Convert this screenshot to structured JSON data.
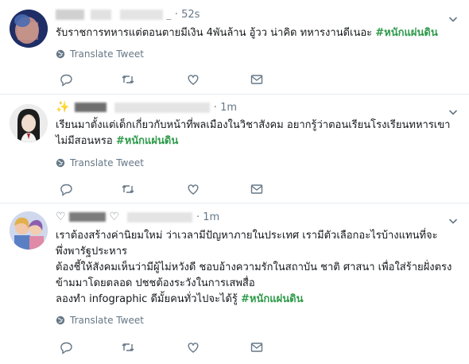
{
  "tweets": [
    {
      "avatar_icon": "user-avatar-blurred",
      "name_glyph": "",
      "handle_suffix": "_",
      "time": "52s",
      "text": "รับราชการทหารแต่ตอนตายมีเงิน 4พันล้าน อู้วว น่าคิด ทหารงานดีเนอะ",
      "hashtag": "#หนักแผ่นดิน",
      "translate_label": "Translate Tweet"
    },
    {
      "avatar_icon": "user-avatar-girl",
      "name_glyph": "✨",
      "handle_suffix": "",
      "time": "1m",
      "text_line1": "เรียนมาตั้งแต่เด็กเกี่ยวกับหน้าที่พลเมืองในวิชาสังคม อยากรู้ว่าตอนเรียนโรงเรียนทหารเขา",
      "text_line2": "ไม่มีสอนหรอ",
      "hashtag": "#หนักแผ่นดิน",
      "translate_label": "Translate Tweet"
    },
    {
      "avatar_icon": "user-avatar-anime",
      "name_glyph": "♡",
      "handle_suffix": "",
      "time": "1m",
      "text_line1": "เราต้องสร้างค่านิยมใหม่ ว่าเวลามีปัญหาภายในประเทศ เรามีตัวเลือกอะไรบ้างแทนที่จะ",
      "text_line2": "พึ่งพารัฐประหาร",
      "text_line3": "ต้องชี้ให้สังคมเห็นว่ามีผู้ไม่หวังดี ชอบอ้างความรักในสถาบัน ชาติ ศาสนา เพื่อใส่ร้ายฝั่งตรง",
      "text_line4": "ข้ามมาโดยตลอด ปชชต้องระวังในการเสพสื่อ",
      "text_line5": "ลองทำ infographic ดีมั้ยคนทั่วไปจะได้รู้",
      "hashtag": "#หนักแผ่นดิน",
      "translate_label": "Translate Tweet"
    }
  ],
  "icons": {
    "translate": "globe-icon",
    "reply": "reply-icon",
    "retweet": "retweet-icon",
    "like": "heart-icon",
    "dm": "mail-icon",
    "more": "chevron-down-icon"
  },
  "colors": {
    "hashtag": "#2e9a4a",
    "muted": "#657786",
    "divider": "#e6ecf0"
  }
}
